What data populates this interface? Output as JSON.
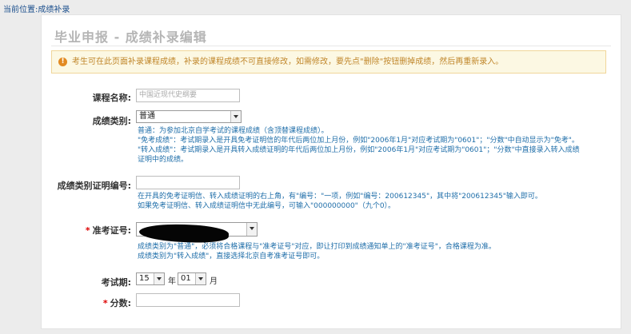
{
  "breadcrumb": "当前位置:成绩补录",
  "page_title": "毕业申报 - 成绩补录编辑",
  "warning": {
    "icon": "exclamation-icon",
    "text": "考生可在此页面补录课程成绩，补录的课程成绩不可直接修改，如需修改，要先点\"删除\"按钮删掉成绩，然后再重新录入。"
  },
  "form": {
    "course_name": {
      "label": "课程名称:",
      "placeholder": "中国近现代史纲要"
    },
    "grade_type": {
      "label": "成绩类别:",
      "value": "普通",
      "help": [
        "普通：为参加北京自学考试的课程成绩（含顶替课程成绩）。",
        "\"免考成绩\"：考试期录入是开具免考证明信的年代后两位加上月份，例如\"2006年1月\"对应考试期为\"0601\"；\"分数\"中自动显示为\"免考\"。",
        "\"转入成绩\"：考试期录入是开具转入成绩证明的年代后两位加上月份，例如\"2006年1月\"对应考试期为\"0601\"；\"分数\"中直接录入转入成绩",
        "证明中的成绩。"
      ]
    },
    "cert_no": {
      "label": "成绩类别证明编号:",
      "value": "",
      "help": [
        "在开具的免考证明信、转入成绩证明的右上角，有\"编号：\"一项，例如\"编号：200612345\"，其中将\"200612345\"输入即可。",
        "如果免考证明信、转入成绩证明信中无此编号，可输入\"000000000\"（九个0）。"
      ]
    },
    "exam_no": {
      "label": "准考证号:",
      "help": [
        "成绩类别为\"普通\"，必须将合格课程与\"准考证号\"对应，即让打印到成绩通知单上的\"准考证号\"，合格课程为准。",
        "成绩类别为\"转入成绩\"，直接选择北京自考准考证号即可。"
      ]
    },
    "exam_period": {
      "label": "考试期:",
      "year_value": "15",
      "year_unit": "年",
      "month_value": "01",
      "month_unit": "月"
    },
    "score": {
      "label": "分数:",
      "value": ""
    }
  }
}
